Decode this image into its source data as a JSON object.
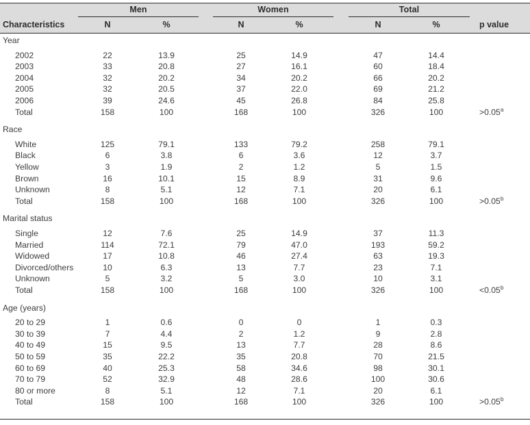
{
  "header": {
    "characteristics_label": "Characteristics",
    "p_value_label": "p value",
    "groups": [
      {
        "label": "Men",
        "n_label": "N",
        "pct_label": "%"
      },
      {
        "label": "Women",
        "n_label": "N",
        "pct_label": "%"
      },
      {
        "label": "Total",
        "n_label": "N",
        "pct_label": "%"
      }
    ]
  },
  "sections": [
    {
      "title": "Year",
      "rows": [
        {
          "label": "2002",
          "men_n": "22",
          "men_pct": "13.9",
          "women_n": "25",
          "women_pct": "14.9",
          "total_n": "47",
          "total_pct": "14.4",
          "p": "",
          "p_sup": ""
        },
        {
          "label": "2003",
          "men_n": "33",
          "men_pct": "20.8",
          "women_n": "27",
          "women_pct": "16.1",
          "total_n": "60",
          "total_pct": "18.4",
          "p": "",
          "p_sup": ""
        },
        {
          "label": "2004",
          "men_n": "32",
          "men_pct": "20.2",
          "women_n": "34",
          "women_pct": "20.2",
          "total_n": "66",
          "total_pct": "20.2",
          "p": "",
          "p_sup": ""
        },
        {
          "label": "2005",
          "men_n": "32",
          "men_pct": "20.5",
          "women_n": "37",
          "women_pct": "22.0",
          "total_n": "69",
          "total_pct": "21.2",
          "p": "",
          "p_sup": ""
        },
        {
          "label": "2006",
          "men_n": "39",
          "men_pct": "24.6",
          "women_n": "45",
          "women_pct": "26.8",
          "total_n": "84",
          "total_pct": "25.8",
          "p": "",
          "p_sup": ""
        },
        {
          "label": "Total",
          "men_n": "158",
          "men_pct": "100",
          "women_n": "168",
          "women_pct": "100",
          "total_n": "326",
          "total_pct": "100",
          "p": ">0.05",
          "p_sup": "a"
        }
      ]
    },
    {
      "title": "Race",
      "rows": [
        {
          "label": "White",
          "men_n": "125",
          "men_pct": "79.1",
          "women_n": "133",
          "women_pct": "79.2",
          "total_n": "258",
          "total_pct": "79.1",
          "p": "",
          "p_sup": ""
        },
        {
          "label": "Black",
          "men_n": "6",
          "men_pct": "3.8",
          "women_n": "6",
          "women_pct": "3.6",
          "total_n": "12",
          "total_pct": "3.7",
          "p": "",
          "p_sup": ""
        },
        {
          "label": "Yellow",
          "men_n": "3",
          "men_pct": "1.9",
          "women_n": "2",
          "women_pct": "1.2",
          "total_n": "5",
          "total_pct": "1.5",
          "p": "",
          "p_sup": ""
        },
        {
          "label": "Brown",
          "men_n": "16",
          "men_pct": "10.1",
          "women_n": "15",
          "women_pct": "8.9",
          "total_n": "31",
          "total_pct": "9.6",
          "p": "",
          "p_sup": ""
        },
        {
          "label": "Unknown",
          "men_n": "8",
          "men_pct": "5.1",
          "women_n": "12",
          "women_pct": "7.1",
          "total_n": "20",
          "total_pct": "6.1",
          "p": "",
          "p_sup": ""
        },
        {
          "label": "Total",
          "men_n": "158",
          "men_pct": "100",
          "women_n": "168",
          "women_pct": "100",
          "total_n": "326",
          "total_pct": "100",
          "p": ">0.05",
          "p_sup": "b"
        }
      ]
    },
    {
      "title": "Marital status",
      "rows": [
        {
          "label": "Single",
          "men_n": "12",
          "men_pct": "7.6",
          "women_n": "25",
          "women_pct": "14.9",
          "total_n": "37",
          "total_pct": "11.3",
          "p": "",
          "p_sup": ""
        },
        {
          "label": "Married",
          "men_n": "114",
          "men_pct": "72.1",
          "women_n": "79",
          "women_pct": "47.0",
          "total_n": "193",
          "total_pct": "59.2",
          "p": "",
          "p_sup": ""
        },
        {
          "label": "Widowed",
          "men_n": "17",
          "men_pct": "10.8",
          "women_n": "46",
          "women_pct": "27.4",
          "total_n": "63",
          "total_pct": "19.3",
          "p": "",
          "p_sup": ""
        },
        {
          "label": "Divorced/others",
          "men_n": "10",
          "men_pct": "6.3",
          "women_n": "13",
          "women_pct": "7.7",
          "total_n": "23",
          "total_pct": "7.1",
          "p": "",
          "p_sup": ""
        },
        {
          "label": "Unknown",
          "men_n": "5",
          "men_pct": "3.2",
          "women_n": "5",
          "women_pct": "3.0",
          "total_n": "10",
          "total_pct": "3.1",
          "p": "",
          "p_sup": ""
        },
        {
          "label": "Total",
          "men_n": "158",
          "men_pct": "100",
          "women_n": "168",
          "women_pct": "100",
          "total_n": "326",
          "total_pct": "100",
          "p": "<0.05",
          "p_sup": "b"
        }
      ]
    },
    {
      "title": "Age (years)",
      "rows": [
        {
          "label": "20 to 29",
          "men_n": "1",
          "men_pct": "0.6",
          "women_n": "0",
          "women_pct": "0",
          "total_n": "1",
          "total_pct": "0.3",
          "p": "",
          "p_sup": ""
        },
        {
          "label": "30 to 39",
          "men_n": "7",
          "men_pct": "4.4",
          "women_n": "2",
          "women_pct": "1.2",
          "total_n": "9",
          "total_pct": "2.8",
          "p": "",
          "p_sup": ""
        },
        {
          "label": "40 to 49",
          "men_n": "15",
          "men_pct": "9.5",
          "women_n": "13",
          "women_pct": "7.7",
          "total_n": "28",
          "total_pct": "8.6",
          "p": "",
          "p_sup": ""
        },
        {
          "label": "50 to 59",
          "men_n": "35",
          "men_pct": "22.2",
          "women_n": "35",
          "women_pct": "20.8",
          "total_n": "70",
          "total_pct": "21.5",
          "p": "",
          "p_sup": ""
        },
        {
          "label": "60 to 69",
          "men_n": "40",
          "men_pct": "25.3",
          "women_n": "58",
          "women_pct": "34.6",
          "total_n": "98",
          "total_pct": "30.1",
          "p": "",
          "p_sup": ""
        },
        {
          "label": "70 to 79",
          "men_n": "52",
          "men_pct": "32.9",
          "women_n": "48",
          "women_pct": "28.6",
          "total_n": "100",
          "total_pct": "30.6",
          "p": "",
          "p_sup": ""
        },
        {
          "label": "80 or more",
          "men_n": "8",
          "men_pct": "5.1",
          "women_n": "12",
          "women_pct": "7.1",
          "total_n": "20",
          "total_pct": "6.1",
          "p": "",
          "p_sup": ""
        },
        {
          "label": "Total",
          "men_n": "158",
          "men_pct": "100",
          "women_n": "168",
          "women_pct": "100",
          "total_n": "326",
          "total_pct": "100",
          "p": ">0.05",
          "p_sup": "b"
        }
      ]
    }
  ]
}
